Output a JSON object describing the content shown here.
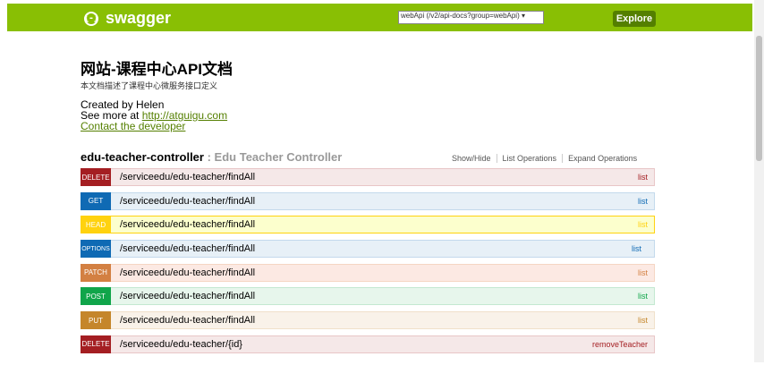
{
  "header": {
    "logo_icon": "{-}",
    "logo_text": "swagger",
    "api_select": "webApi (/v2/api-docs?group=webApi)",
    "explore_label": "Explore"
  },
  "info": {
    "title": "网站-课程中心API文档",
    "description": "本文档描述了课程中心微服务接口定义",
    "created_by": "Created by Helen",
    "see_more_prefix": "See more at ",
    "see_more_link": "http://atguigu.com",
    "contact_link": "Contact the developer"
  },
  "controller": {
    "name": "edu-teacher-controller",
    "separator": " : ",
    "description": "Edu Teacher Controller",
    "show_hide": "Show/Hide",
    "list_operations": "List Operations",
    "expand_operations": "Expand Operations"
  },
  "operations": [
    {
      "method": "DELETE",
      "path": "/serviceedu/edu-teacher/findAll",
      "summary": "list",
      "color": "#a41e22"
    },
    {
      "method": "GET",
      "path": "/serviceedu/edu-teacher/findAll",
      "summary": "list",
      "color": "#0f6ab4"
    },
    {
      "method": "HEAD",
      "path": "/serviceedu/edu-teacher/findAll",
      "summary": "list",
      "color": "#ffd20f"
    },
    {
      "method": "OPTIONS",
      "path": "/serviceedu/edu-teacher/findAll",
      "summary": "list",
      "color": "#0f6ab4"
    },
    {
      "method": "PATCH",
      "path": "/serviceedu/edu-teacher/findAll",
      "summary": "list",
      "color": "#d38042"
    },
    {
      "method": "POST",
      "path": "/serviceedu/edu-teacher/findAll",
      "summary": "list",
      "color": "#10a54a"
    },
    {
      "method": "PUT",
      "path": "/serviceedu/edu-teacher/findAll",
      "summary": "list",
      "color": "#c5862b"
    },
    {
      "method": "DELETE",
      "path": "/serviceedu/edu-teacher/{id}",
      "summary": "removeTeacher",
      "color": "#a41e22"
    }
  ],
  "colors": {
    "header_bg": "#89bf04",
    "explore_bg": "#547f00",
    "link": "#547f00"
  }
}
